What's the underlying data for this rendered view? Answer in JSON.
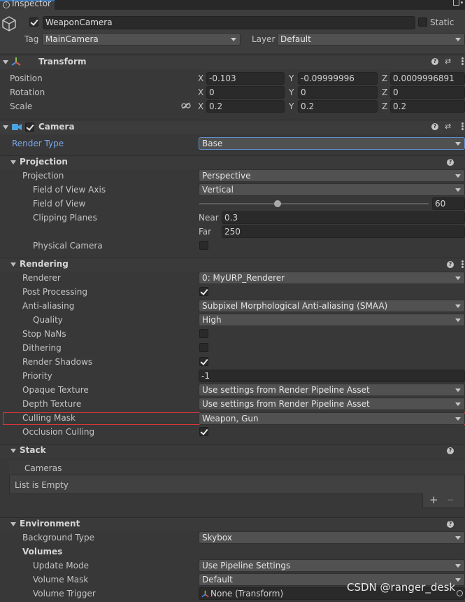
{
  "tab": {
    "title": "Inspector"
  },
  "object": {
    "name": "WeaponCamera",
    "static_label": "Static",
    "tag_label": "Tag",
    "tag_value": "MainCamera",
    "layer_label": "Layer",
    "layer_value": "Default"
  },
  "transform": {
    "title": "Transform",
    "position_label": "Position",
    "rotation_label": "Rotation",
    "scale_label": "Scale",
    "x": "X",
    "y": "Y",
    "z": "Z",
    "position": {
      "x": "-0.103",
      "y": "-0.09999996",
      "z": "0.0009996891"
    },
    "rotation": {
      "x": "0",
      "y": "0",
      "z": "0"
    },
    "scale": {
      "x": "0.2",
      "y": "0.2",
      "z": "0.2"
    }
  },
  "camera": {
    "title": "Camera",
    "render_type_label": "Render Type",
    "render_type_value": "Base"
  },
  "projection": {
    "section": "Projection",
    "projection_label": "Projection",
    "projection_value": "Perspective",
    "fov_axis_label": "Field of View Axis",
    "fov_axis_value": "Vertical",
    "fov_label": "Field of View",
    "fov_value": "60",
    "fov_slider_fraction": 0.34,
    "clipping_label": "Clipping Planes",
    "near_label": "Near",
    "near_value": "0.3",
    "far_label": "Far",
    "far_value": "250",
    "physical_label": "Physical Camera"
  },
  "rendering": {
    "section": "Rendering",
    "renderer_label": "Renderer",
    "renderer_value": "0: MyURP_Renderer",
    "post_label": "Post Processing",
    "aa_label": "Anti-aliasing",
    "aa_value": "Subpixel Morphological Anti-aliasing (SMAA)",
    "quality_label": "Quality",
    "quality_value": "High",
    "stopnans_label": "Stop NaNs",
    "dither_label": "Dithering",
    "shadows_label": "Render Shadows",
    "priority_label": "Priority",
    "priority_value": "-1",
    "opaque_label": "Opaque Texture",
    "opaque_value": "Use settings from Render Pipeline Asset",
    "depth_label": "Depth Texture",
    "depth_value": "Use settings from Render Pipeline Asset",
    "culling_label": "Culling Mask",
    "culling_value": "Weapon, Gun",
    "occlusion_label": "Occlusion Culling"
  },
  "stack": {
    "section": "Stack",
    "list_header": "Cameras",
    "empty_text": "List is Empty",
    "add_symbol": "+",
    "remove_symbol": "−"
  },
  "environment": {
    "section": "Environment",
    "bg_label": "Background Type",
    "bg_value": "Skybox",
    "volumes_label": "Volumes",
    "update_label": "Update Mode",
    "update_value": "Use Pipeline Settings",
    "mask_label": "Volume Mask",
    "mask_value": "Default",
    "trigger_label": "Volume Trigger",
    "trigger_value": "None (Transform)"
  },
  "watermark": "CSDN @ranger_desk",
  "colors": {
    "background": "#383838",
    "highlight_outline": "#d9373a",
    "render_type_label": "#7aa7e8",
    "camera_icon": "#4aa3df"
  }
}
